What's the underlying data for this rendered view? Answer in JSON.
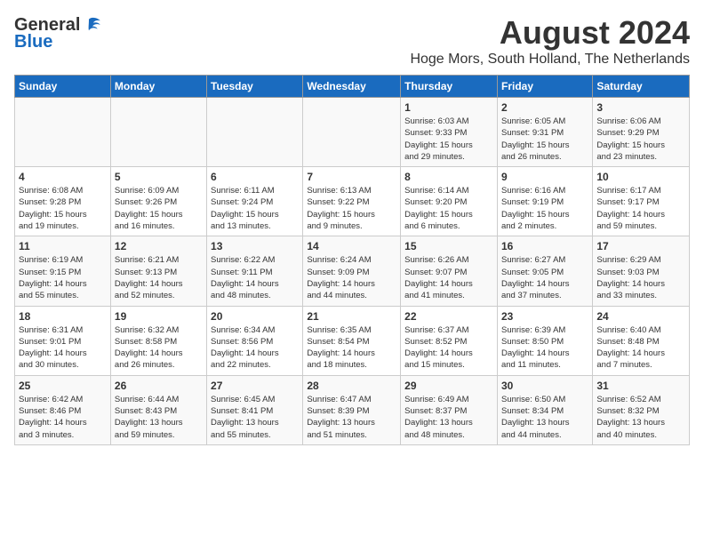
{
  "logo": {
    "general": "General",
    "blue": "Blue"
  },
  "title": {
    "month_year": "August 2024",
    "location": "Hoge Mors, South Holland, The Netherlands"
  },
  "headers": [
    "Sunday",
    "Monday",
    "Tuesday",
    "Wednesday",
    "Thursday",
    "Friday",
    "Saturday"
  ],
  "weeks": [
    [
      {
        "day": "",
        "content": ""
      },
      {
        "day": "",
        "content": ""
      },
      {
        "day": "",
        "content": ""
      },
      {
        "day": "",
        "content": ""
      },
      {
        "day": "1",
        "content": "Sunrise: 6:03 AM\nSunset: 9:33 PM\nDaylight: 15 hours\nand 29 minutes."
      },
      {
        "day": "2",
        "content": "Sunrise: 6:05 AM\nSunset: 9:31 PM\nDaylight: 15 hours\nand 26 minutes."
      },
      {
        "day": "3",
        "content": "Sunrise: 6:06 AM\nSunset: 9:29 PM\nDaylight: 15 hours\nand 23 minutes."
      }
    ],
    [
      {
        "day": "4",
        "content": "Sunrise: 6:08 AM\nSunset: 9:28 PM\nDaylight: 15 hours\nand 19 minutes."
      },
      {
        "day": "5",
        "content": "Sunrise: 6:09 AM\nSunset: 9:26 PM\nDaylight: 15 hours\nand 16 minutes."
      },
      {
        "day": "6",
        "content": "Sunrise: 6:11 AM\nSunset: 9:24 PM\nDaylight: 15 hours\nand 13 minutes."
      },
      {
        "day": "7",
        "content": "Sunrise: 6:13 AM\nSunset: 9:22 PM\nDaylight: 15 hours\nand 9 minutes."
      },
      {
        "day": "8",
        "content": "Sunrise: 6:14 AM\nSunset: 9:20 PM\nDaylight: 15 hours\nand 6 minutes."
      },
      {
        "day": "9",
        "content": "Sunrise: 6:16 AM\nSunset: 9:19 PM\nDaylight: 15 hours\nand 2 minutes."
      },
      {
        "day": "10",
        "content": "Sunrise: 6:17 AM\nSunset: 9:17 PM\nDaylight: 14 hours\nand 59 minutes."
      }
    ],
    [
      {
        "day": "11",
        "content": "Sunrise: 6:19 AM\nSunset: 9:15 PM\nDaylight: 14 hours\nand 55 minutes."
      },
      {
        "day": "12",
        "content": "Sunrise: 6:21 AM\nSunset: 9:13 PM\nDaylight: 14 hours\nand 52 minutes."
      },
      {
        "day": "13",
        "content": "Sunrise: 6:22 AM\nSunset: 9:11 PM\nDaylight: 14 hours\nand 48 minutes."
      },
      {
        "day": "14",
        "content": "Sunrise: 6:24 AM\nSunset: 9:09 PM\nDaylight: 14 hours\nand 44 minutes."
      },
      {
        "day": "15",
        "content": "Sunrise: 6:26 AM\nSunset: 9:07 PM\nDaylight: 14 hours\nand 41 minutes."
      },
      {
        "day": "16",
        "content": "Sunrise: 6:27 AM\nSunset: 9:05 PM\nDaylight: 14 hours\nand 37 minutes."
      },
      {
        "day": "17",
        "content": "Sunrise: 6:29 AM\nSunset: 9:03 PM\nDaylight: 14 hours\nand 33 minutes."
      }
    ],
    [
      {
        "day": "18",
        "content": "Sunrise: 6:31 AM\nSunset: 9:01 PM\nDaylight: 14 hours\nand 30 minutes."
      },
      {
        "day": "19",
        "content": "Sunrise: 6:32 AM\nSunset: 8:58 PM\nDaylight: 14 hours\nand 26 minutes."
      },
      {
        "day": "20",
        "content": "Sunrise: 6:34 AM\nSunset: 8:56 PM\nDaylight: 14 hours\nand 22 minutes."
      },
      {
        "day": "21",
        "content": "Sunrise: 6:35 AM\nSunset: 8:54 PM\nDaylight: 14 hours\nand 18 minutes."
      },
      {
        "day": "22",
        "content": "Sunrise: 6:37 AM\nSunset: 8:52 PM\nDaylight: 14 hours\nand 15 minutes."
      },
      {
        "day": "23",
        "content": "Sunrise: 6:39 AM\nSunset: 8:50 PM\nDaylight: 14 hours\nand 11 minutes."
      },
      {
        "day": "24",
        "content": "Sunrise: 6:40 AM\nSunset: 8:48 PM\nDaylight: 14 hours\nand 7 minutes."
      }
    ],
    [
      {
        "day": "25",
        "content": "Sunrise: 6:42 AM\nSunset: 8:46 PM\nDaylight: 14 hours\nand 3 minutes."
      },
      {
        "day": "26",
        "content": "Sunrise: 6:44 AM\nSunset: 8:43 PM\nDaylight: 13 hours\nand 59 minutes."
      },
      {
        "day": "27",
        "content": "Sunrise: 6:45 AM\nSunset: 8:41 PM\nDaylight: 13 hours\nand 55 minutes."
      },
      {
        "day": "28",
        "content": "Sunrise: 6:47 AM\nSunset: 8:39 PM\nDaylight: 13 hours\nand 51 minutes."
      },
      {
        "day": "29",
        "content": "Sunrise: 6:49 AM\nSunset: 8:37 PM\nDaylight: 13 hours\nand 48 minutes."
      },
      {
        "day": "30",
        "content": "Sunrise: 6:50 AM\nSunset: 8:34 PM\nDaylight: 13 hours\nand 44 minutes."
      },
      {
        "day": "31",
        "content": "Sunrise: 6:52 AM\nSunset: 8:32 PM\nDaylight: 13 hours\nand 40 minutes."
      }
    ]
  ]
}
